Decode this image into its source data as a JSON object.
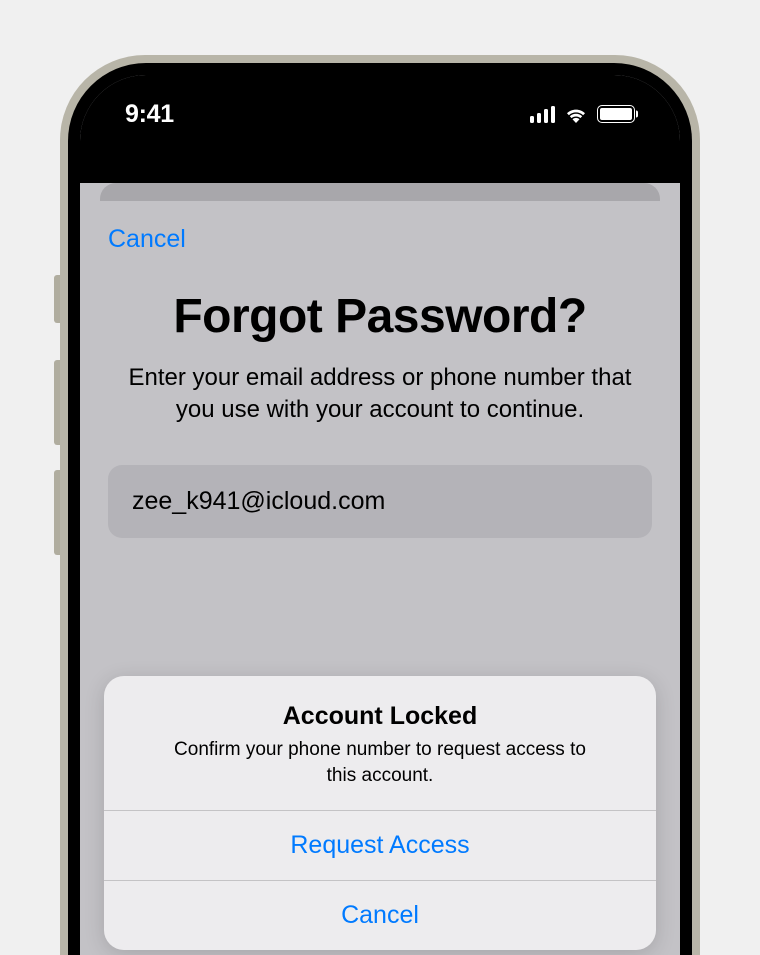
{
  "statusBar": {
    "time": "9:41"
  },
  "sheet": {
    "cancel": "Cancel",
    "title": "Forgot Password?",
    "subtitle": "Enter your email address or phone number that you use with your account to continue.",
    "emailValue": "zee_k941@icloud.com"
  },
  "alert": {
    "title": "Account Locked",
    "message": "Confirm your phone number to request access to this account.",
    "primary": "Request Access",
    "cancel": "Cancel"
  }
}
